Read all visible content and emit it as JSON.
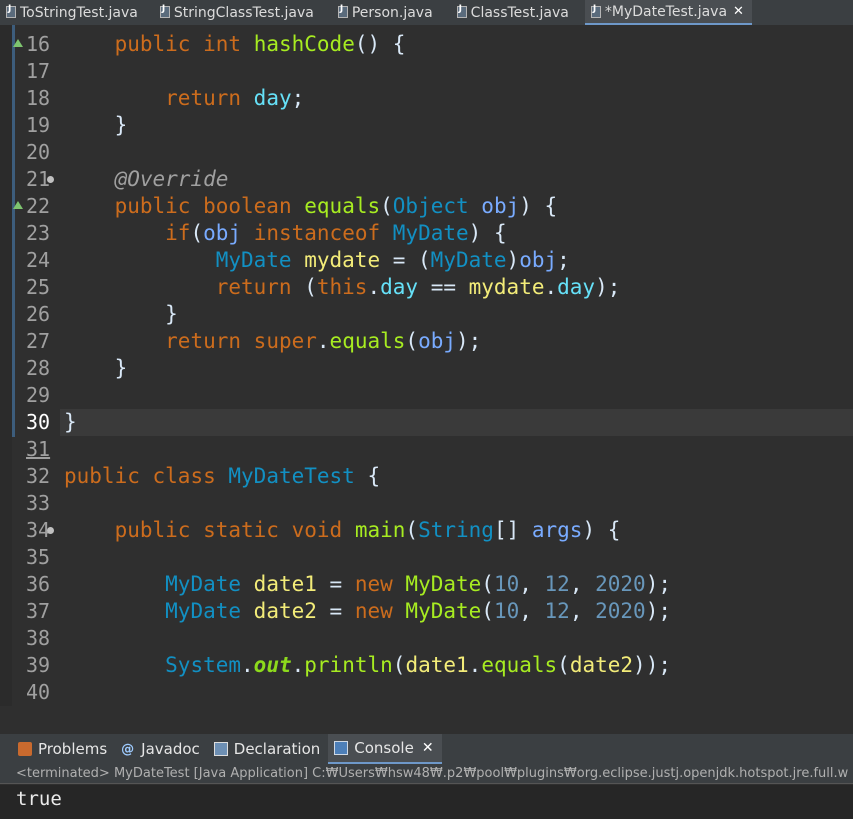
{
  "editor_tabs": [
    {
      "label": "ToStringTest.java",
      "active": false
    },
    {
      "label": "StringClassTest.java",
      "active": false
    },
    {
      "label": "Person.java",
      "active": false
    },
    {
      "label": "ClassTest.java",
      "active": false
    },
    {
      "label": "*MyDateTest.java",
      "active": true,
      "close": "✕"
    }
  ],
  "lines": [
    {
      "n": "16"
    },
    {
      "n": "17"
    },
    {
      "n": "18"
    },
    {
      "n": "19"
    },
    {
      "n": "20"
    },
    {
      "n": "21"
    },
    {
      "n": "22"
    },
    {
      "n": "23"
    },
    {
      "n": "24"
    },
    {
      "n": "25"
    },
    {
      "n": "26"
    },
    {
      "n": "27"
    },
    {
      "n": "28"
    },
    {
      "n": "29"
    },
    {
      "n": "30"
    },
    {
      "n": "31"
    },
    {
      "n": "32"
    },
    {
      "n": "33"
    },
    {
      "n": "34"
    },
    {
      "n": "35"
    },
    {
      "n": "36"
    },
    {
      "n": "37"
    },
    {
      "n": "38"
    },
    {
      "n": "39"
    },
    {
      "n": "40"
    }
  ],
  "code": {
    "l16": [
      "public",
      "int",
      "hashCode",
      "() {"
    ],
    "l18": [
      "return",
      "day",
      ";"
    ],
    "l19": "}",
    "l21": "@Override",
    "l22": [
      "public",
      "boolean",
      "equals",
      "(",
      "Object",
      "obj",
      ") {"
    ],
    "l23": [
      "if",
      "(",
      "obj",
      "instanceof",
      "MyDate",
      ") {"
    ],
    "l24": [
      "MyDate",
      "mydate",
      " = (",
      "MyDate",
      ")",
      "obj",
      ";"
    ],
    "l25": [
      "return",
      " (",
      "this",
      ".",
      "day",
      " == ",
      "mydate",
      ".",
      "day",
      ");"
    ],
    "l26": "}",
    "l27": [
      "return",
      "super",
      ".",
      "equals",
      "(",
      "obj",
      ");"
    ],
    "l28": "}",
    "l30": "}",
    "l32": [
      "public",
      "class",
      "MyDateTest",
      " {"
    ],
    "l34": [
      "public",
      "static",
      "void",
      "main",
      "(",
      "String",
      "[] ",
      "args",
      ") {"
    ],
    "l36": [
      "MyDate",
      "date1",
      " = ",
      "new",
      "MyDate",
      "(",
      "10",
      ", ",
      "12",
      ", ",
      "2020",
      ");"
    ],
    "l37": [
      "MyDate",
      "date2",
      " = ",
      "new",
      "MyDate",
      "(",
      "10",
      ", ",
      "12",
      ", ",
      "2020",
      ");"
    ],
    "l39": [
      "System",
      ".",
      "out",
      ".",
      "println",
      "(",
      "date1",
      ".",
      "equals",
      "(",
      "date2",
      "));"
    ]
  },
  "scroll_left": "<",
  "panel_tabs": [
    {
      "label": "Problems",
      "icon": "problems-icon",
      "active": false
    },
    {
      "label": "Javadoc",
      "icon": "javadoc-icon",
      "active": false
    },
    {
      "label": "Declaration",
      "icon": "declaration-icon",
      "active": false
    },
    {
      "label": "Console",
      "icon": "console-icon",
      "active": true,
      "close": "✕"
    }
  ],
  "console": {
    "status": "<terminated> MyDateTest [Java Application] C:₩Users₩hsw48₩.p2₩pool₩plugins₩org.eclipse.justj.openjdk.hotspot.jre.full.w",
    "output": "true"
  }
}
